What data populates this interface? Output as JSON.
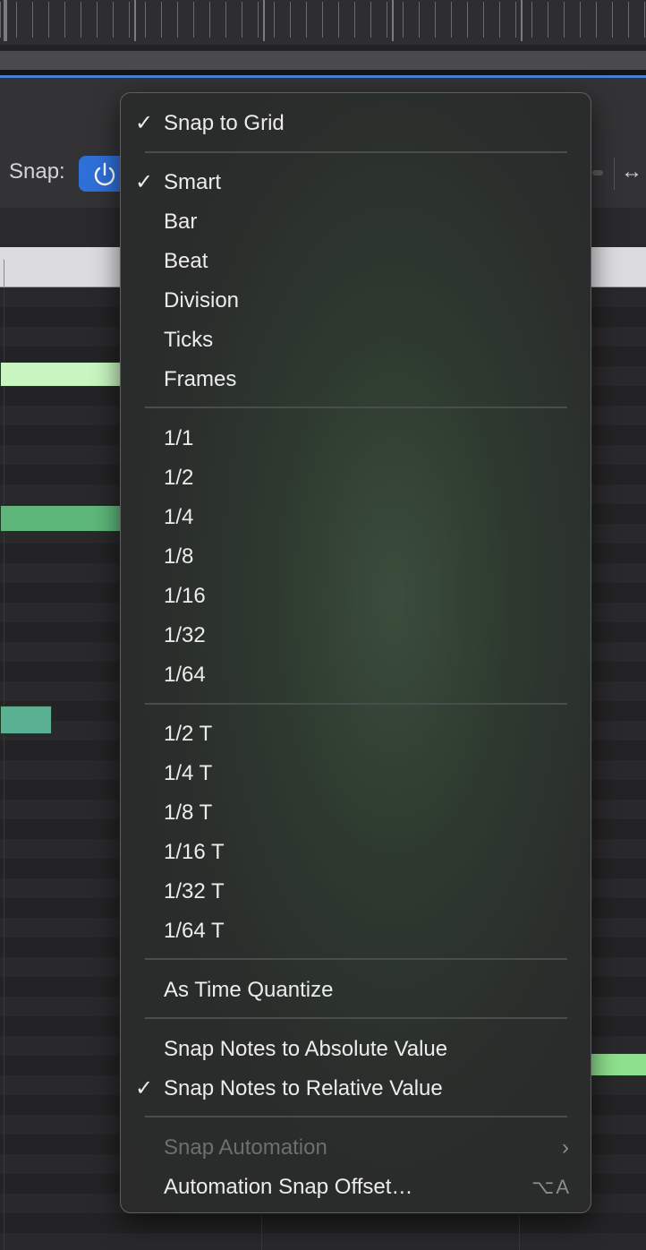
{
  "toolbar": {
    "snap_label": "Snap:",
    "right_arrows_icon": "↔"
  },
  "menu": {
    "snap_to_grid": "Snap to Grid",
    "modes": [
      "Smart",
      "Bar",
      "Beat",
      "Division",
      "Ticks",
      "Frames"
    ],
    "values": [
      "1/1",
      "1/2",
      "1/4",
      "1/8",
      "1/16",
      "1/32",
      "1/64"
    ],
    "triplets": [
      "1/2 T",
      "1/4 T",
      "1/8 T",
      "1/16 T",
      "1/32 T",
      "1/64 T"
    ],
    "as_time_quantize": "As Time Quantize",
    "snap_absolute": "Snap Notes to Absolute Value",
    "snap_relative": "Snap Notes to Relative Value",
    "snap_automation": "Snap Automation",
    "automation_offset": "Automation Snap Offset…",
    "automation_offset_shortcut": "⌥A",
    "checkmark": "✓",
    "chevron": "›"
  },
  "colors": {
    "accent_blue": "#2f6fd8",
    "menu_text": "#ececec",
    "disabled_text": "#6c6f70"
  }
}
